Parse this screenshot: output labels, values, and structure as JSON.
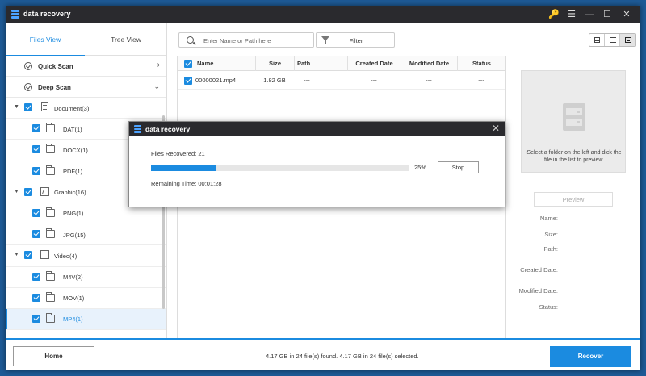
{
  "app": {
    "title": "data recovery"
  },
  "window_controls": {
    "key": "🔑",
    "menu": "☰",
    "minimize": "—",
    "maximize": "☐",
    "close": "✕"
  },
  "view_tabs": [
    {
      "label": "Files View",
      "active": true
    },
    {
      "label": "Tree View",
      "active": false
    }
  ],
  "scan": {
    "quick": "Quick Scan",
    "deep": "Deep Scan"
  },
  "tree": {
    "document": "Document(3)",
    "dat": "DAT(1)",
    "docx": "DOCX(1)",
    "pdf": "PDF(1)",
    "graphic": "Graphic(16)",
    "png": "PNG(1)",
    "jpg": "JPG(15)",
    "video": "Video(4)",
    "m4v": "M4V(2)",
    "mov": "MOV(1)",
    "mp4": "MP4(1)"
  },
  "search": {
    "placeholder": "Enter Name or Path here"
  },
  "filter": {
    "label": "Filter"
  },
  "table": {
    "headers": {
      "name": "Name",
      "size": "Size",
      "path": "Path",
      "created": "Created Date",
      "modified": "Modified Date",
      "status": "Status"
    },
    "row": {
      "name": "00000021.mp4",
      "size": "1.82 GB",
      "path": "---",
      "created": "---",
      "modified": "---",
      "status": "---"
    }
  },
  "preview": {
    "hint": "Select a folder on the left and dick the file in the list to preview.",
    "button": "Preview",
    "labels": {
      "name": "Name:",
      "size": "Size:",
      "path": "Path:",
      "created": "Created Date:",
      "modified": "Modified Date:",
      "status": "Status:"
    }
  },
  "footer": {
    "home": "Home",
    "status": "4.17 GB in 24 file(s) found.   4.17 GB in 24 file(s) selected.",
    "recover": "Recover"
  },
  "dialog": {
    "title": "data recovery",
    "close": "✕",
    "files_recovered": "Files Recovered: 21",
    "progress": 0.25,
    "progress_text": "25%",
    "stop": "Stop",
    "remaining": "Remaining Time: 00:01:28"
  },
  "colors": {
    "accent": "#1b8be0",
    "titlebar": "#2a2a2e",
    "desktop": "#1e5a96"
  }
}
